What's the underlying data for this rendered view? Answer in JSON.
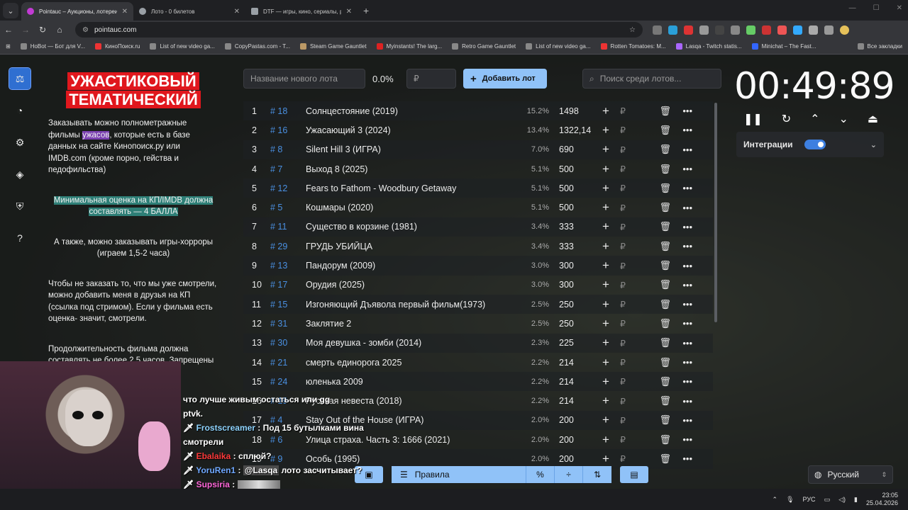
{
  "browser": {
    "tabs": [
      {
        "title": "Pointauc – Аукционы, лотереи",
        "active": true
      },
      {
        "title": "Лото - 0 билетов",
        "active": false
      },
      {
        "title": "DTF — игры, кино, сериалы, р",
        "active": false
      }
    ],
    "url": "pointauc.com",
    "bookmarks": [
      "HoBot — Бот для V...",
      "КиноПоиск.ru",
      "List of new video ga...",
      "CopyPastas.com - T...",
      "Steam Game Gauntlet",
      "Myinstants! The larg...",
      "Retro Game Gauntlet",
      "List of new video ga...",
      "Rotten Tomatoes: M...",
      "Lasqa - Twitch statis...",
      "Minichat – The Fast...",
      "Все закладки"
    ]
  },
  "rules": {
    "title_line1": "УЖАСТИКОВЫЙ",
    "title_line2": "ТЕМАТИЧЕСКИЙ",
    "p1_a": "Заказывать можно полнометражные фильмы ",
    "p1_hl": "ужасов",
    "p1_b": ", которые есть в базе данных на сайте Кинопоиск.ру или IMDB.com (кроме порно, гейства и педофильства)",
    "p2": "Минимальная оценка на КП/IMDB должна составлять — 4 БАЛЛА",
    "p3": "А также, можно заказывать игры-хорроры (играем 1,5-2 часа)",
    "p4": "Чтобы не заказать то, что мы уже смотрели, можно добавить меня в друзья на КП (ссылка под стримом). Если у фильма есть оценка- значит, смотрели.",
    "p5_a": "Продолжительность фильма должна составлять ",
    "p5_hl": "не более 2,5 часов",
    "p5_b": ". Запрещены фильмы старше 1965 года."
  },
  "toolbar": {
    "lot_placeholder": "Название нового лота",
    "percent": "0.0%",
    "amount_placeholder": "₽",
    "add_label": "Добавить лот",
    "search_placeholder": "Поиск среди лотов..."
  },
  "lots": [
    {
      "n": "1",
      "id": "# 18",
      "name": "Солнцестояние (2019)",
      "pct": "15.2%",
      "amount": "1498"
    },
    {
      "n": "2",
      "id": "# 16",
      "name": "Ужасающий 3 (2024)",
      "pct": "13.4%",
      "amount": "1322,14"
    },
    {
      "n": "3",
      "id": "# 8",
      "name": "Silent Hill 3 (ИГРА)",
      "pct": "7.0%",
      "amount": "690"
    },
    {
      "n": "4",
      "id": "# 7",
      "name": "Выход 8 (2025)",
      "pct": "5.1%",
      "amount": "500"
    },
    {
      "n": "5",
      "id": "# 12",
      "name": "Fears to Fathom - Woodbury Getaway",
      "pct": "5.1%",
      "amount": "500"
    },
    {
      "n": "6",
      "id": "# 5",
      "name": "Кошмары (2020)",
      "pct": "5.1%",
      "amount": "500"
    },
    {
      "n": "7",
      "id": "# 11",
      "name": "Существо в корзине (1981)",
      "pct": "3.4%",
      "amount": "333"
    },
    {
      "n": "8",
      "id": "# 29",
      "name": "ГРУДЬ УБИЙЦА",
      "pct": "3.4%",
      "amount": "333"
    },
    {
      "n": "9",
      "id": "# 13",
      "name": "Пандорум (2009)",
      "pct": "3.0%",
      "amount": "300"
    },
    {
      "n": "10",
      "id": "# 17",
      "name": "Орудия (2025)",
      "pct": "3.0%",
      "amount": "300"
    },
    {
      "n": "11",
      "id": "# 15",
      "name": "Изгоняющий Дъявола первый фильм(1973)",
      "pct": "2.5%",
      "amount": "250"
    },
    {
      "n": "12",
      "id": "# 31",
      "name": "Заклятие 2",
      "pct": "2.5%",
      "amount": "250"
    },
    {
      "n": "13",
      "id": "# 30",
      "name": "Моя девушка - зомби (2014)",
      "pct": "2.3%",
      "amount": "225"
    },
    {
      "n": "14",
      "id": "# 21",
      "name": "смерть единорога 2025",
      "pct": "2.2%",
      "amount": "214"
    },
    {
      "n": "15",
      "id": "# 24",
      "name": "юленька 2009",
      "pct": "2.2%",
      "amount": "214"
    },
    {
      "n": "16",
      "id": "# 19",
      "name": "Русская невеста (2018)",
      "pct": "2.2%",
      "amount": "214"
    },
    {
      "n": "17",
      "id": "# 4",
      "name": "Stay Out of the House (ИГРА)",
      "pct": "2.0%",
      "amount": "200"
    },
    {
      "n": "18",
      "id": "# 6",
      "name": "Улица страха. Часть 3: 1666 (2021)",
      "pct": "2.0%",
      "amount": "200"
    },
    {
      "n": "19",
      "id": "# 9",
      "name": "Особь (1995)",
      "pct": "2.0%",
      "amount": "200"
    }
  ],
  "bottom": {
    "rules_label": "Правила"
  },
  "timer": {
    "value": "00:49:89"
  },
  "integrations": {
    "label": "Интеграции"
  },
  "language": {
    "value": "Русский"
  },
  "chat": [
    {
      "nick": "",
      "text": "что лучше живым остаться или gg"
    },
    {
      "nick": "",
      "text": "ptvk."
    },
    {
      "nick": "Frostscreamer",
      "text": "Под 15 бутылками вина смотрели"
    },
    {
      "nick": "Ebalaika",
      "text": "сплюй?"
    },
    {
      "nick": "YoruRen1",
      "mention": "@Lasqa",
      "text": "лото засчитывает?"
    },
    {
      "nick": "Supsiria",
      "text": ""
    }
  ],
  "taskbar": {
    "lang": "РУС",
    "time": "23:05",
    "date": "25.04.2026"
  }
}
